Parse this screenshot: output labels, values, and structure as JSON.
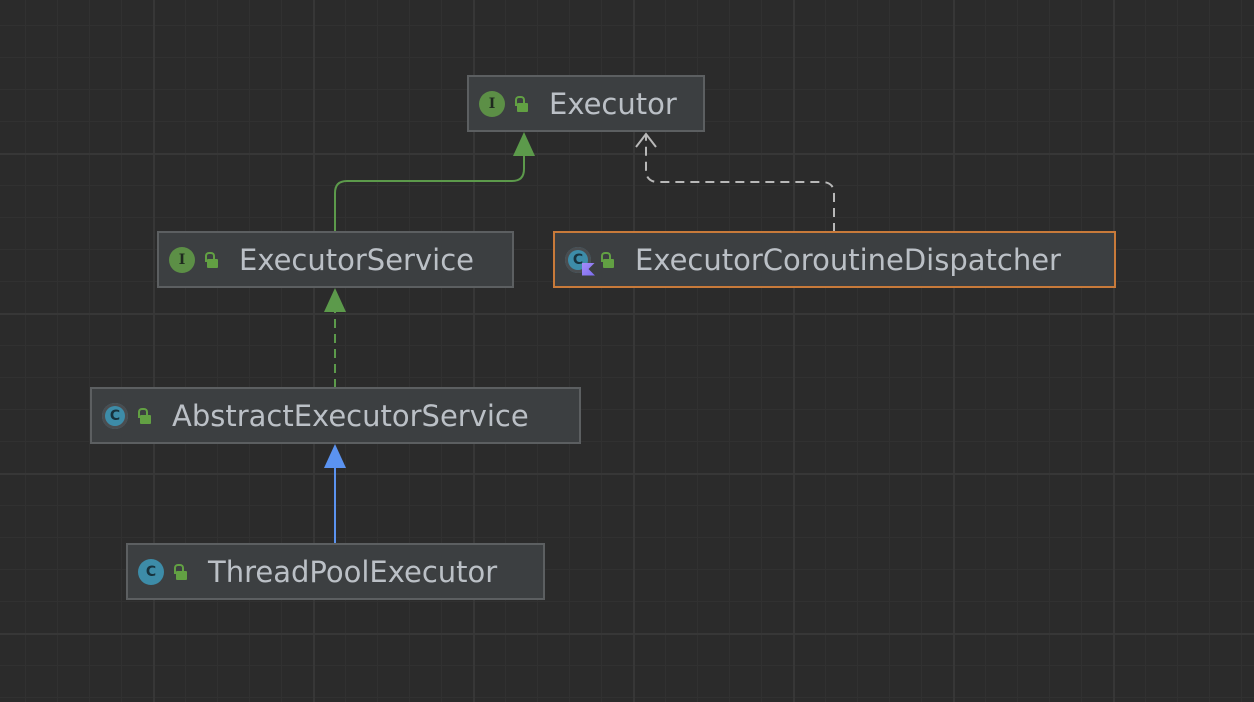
{
  "colors": {
    "canvas": "#2b2b2b",
    "node_fill": "#3c3f41",
    "node_border": "#5c5f61",
    "selected_border": "#c87a3a",
    "extends_interface_edge": "#5c9a4b",
    "implements_edge": "#5c9a4b",
    "extends_class_edge": "#5b93f0",
    "dependency_edge": "#b8b8b8"
  },
  "nodes": [
    {
      "id": "executor",
      "label": "Executor",
      "kind": "interface",
      "kind_letter": "I"
    },
    {
      "id": "executor-service",
      "label": "ExecutorService",
      "kind": "interface",
      "kind_letter": "I"
    },
    {
      "id": "executor-coroutine-dispatcher",
      "label": "ExecutorCoroutineDispatcher",
      "kind": "abstract-class-kotlin",
      "kind_letter": "C",
      "selected": true
    },
    {
      "id": "abstract-executor-service",
      "label": "AbstractExecutorService",
      "kind": "abstract-class",
      "kind_letter": "C"
    },
    {
      "id": "thread-pool-executor",
      "label": "ThreadPoolExecutor",
      "kind": "class",
      "kind_letter": "C"
    }
  ],
  "edges": [
    {
      "from": "executor-service",
      "to": "executor",
      "type": "extends-interface"
    },
    {
      "from": "executor-coroutine-dispatcher",
      "to": "executor",
      "type": "dependency"
    },
    {
      "from": "abstract-executor-service",
      "to": "executor-service",
      "type": "implements"
    },
    {
      "from": "thread-pool-executor",
      "to": "abstract-executor-service",
      "type": "extends-class"
    }
  ]
}
